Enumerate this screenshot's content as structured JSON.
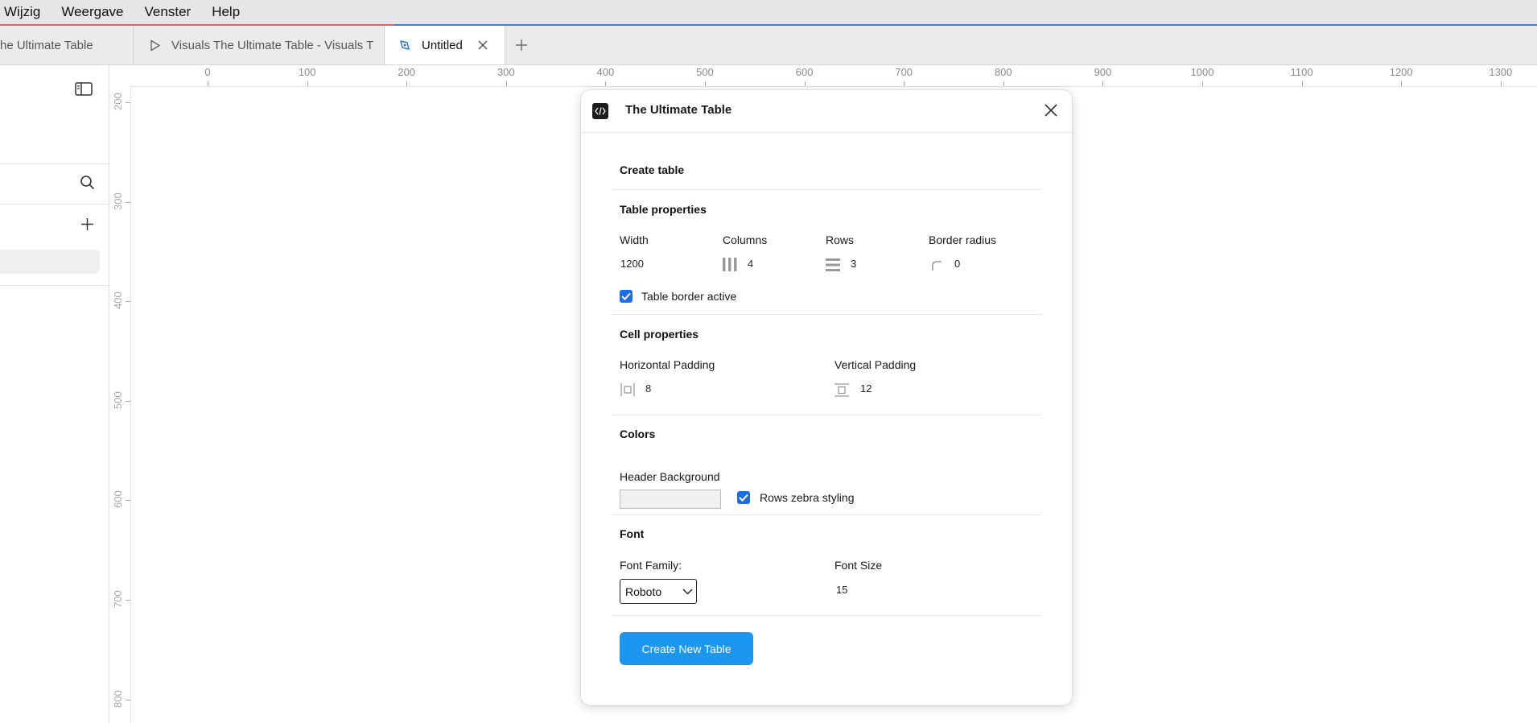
{
  "menubar": {
    "items": [
      "Wijzig",
      "Weergave",
      "Venster",
      "Help"
    ]
  },
  "tabs": [
    {
      "label": "he Ultimate Table",
      "icon": "none"
    },
    {
      "label": "Visuals The Ultimate Table - Visuals T",
      "icon": "play-icon"
    },
    {
      "label": "Untitled",
      "icon": "pen-tool-icon",
      "active": true
    }
  ],
  "ruler": {
    "top_labels": [
      "0",
      "100",
      "200",
      "300",
      "400",
      "500",
      "600",
      "700",
      "800",
      "900",
      "1000",
      "1100",
      "1200",
      "1300"
    ],
    "left_labels": [
      "200",
      "300",
      "400",
      "500",
      "600",
      "700",
      "800"
    ]
  },
  "dialog": {
    "title": "The Ultimate Table",
    "create_table": "Create table",
    "table_properties": {
      "heading": "Table properties",
      "width_label": "Width",
      "width_value": "1200",
      "columns_label": "Columns",
      "columns_value": "4",
      "rows_label": "Rows",
      "rows_value": "3",
      "radius_label": "Border radius",
      "radius_value": "0",
      "border_active_label": "Table border active",
      "border_active": true
    },
    "cell_properties": {
      "heading": "Cell properties",
      "hpad_label": "Horizontal Padding",
      "hpad_value": "8",
      "vpad_label": "Vertical Padding",
      "vpad_value": "12"
    },
    "colors": {
      "heading": "Colors",
      "header_bg_label": "Header Background",
      "header_bg_value": "#f0f0f0",
      "zebra_label": "Rows zebra styling",
      "zebra": true
    },
    "font": {
      "heading": "Font",
      "family_label": "Font Family:",
      "family_value": "Roboto",
      "size_label": "Font Size",
      "size_value": "15"
    },
    "create_button": "Create New Table"
  },
  "colors": {
    "primary_button": "#1b96f1",
    "checkbox": "#1b6ee8"
  }
}
